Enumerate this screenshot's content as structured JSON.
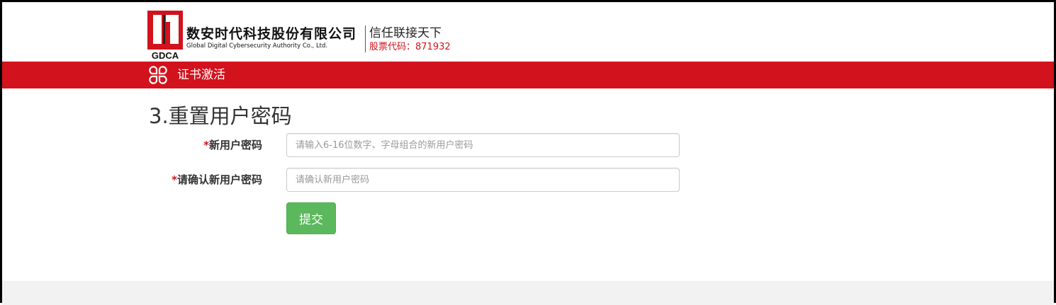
{
  "header": {
    "logo_abbr": "GDCA",
    "company_cn": "数安时代科技股份有限公司",
    "company_en": "Global Digital Cybersecurity Authority Co., Ltd.",
    "slogan": "信任联接天下",
    "stock_code": "股票代码：871932",
    "brand_color": "#d2121c"
  },
  "nav": {
    "icon": "clover-grid-icon",
    "title": "证书激活"
  },
  "page": {
    "heading": "3.重置用户密码"
  },
  "form": {
    "required_mark": "*",
    "new_password_label": "新用户密码",
    "new_password_value": "",
    "new_password_placeholder": "请输入6-16位数字、字母组合的新用户密码",
    "confirm_password_label": "请确认新用户密码",
    "confirm_password_value": "",
    "confirm_password_placeholder": "请确认新用户密码",
    "submit_label": "提交",
    "submit_color": "#5cb85c"
  }
}
